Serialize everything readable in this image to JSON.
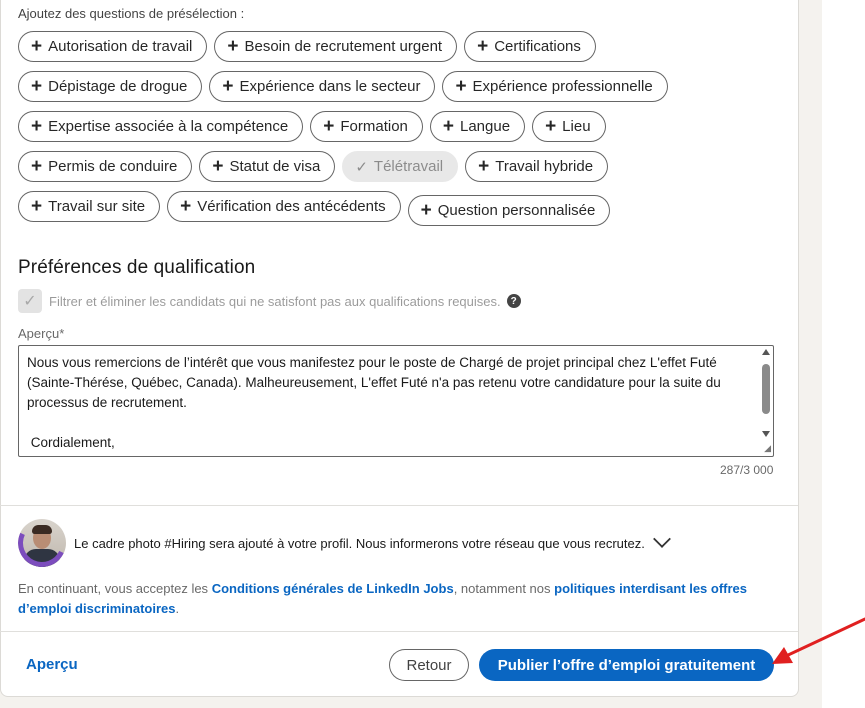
{
  "screening": {
    "hint": "Ajoutez des questions de présélection :",
    "rows": [
      [
        {
          "label": "Autorisation de travail"
        },
        {
          "label": "Besoin de recrutement urgent"
        },
        {
          "label": "Certifications"
        }
      ],
      [
        {
          "label": "Dépistage de drogue"
        },
        {
          "label": "Expérience dans le secteur"
        },
        {
          "label": "Expérience professionnelle"
        }
      ],
      [
        {
          "label": "Expertise associée à la compétence"
        },
        {
          "label": "Formation"
        },
        {
          "label": "Langue"
        },
        {
          "label": "Lieu"
        }
      ],
      [
        {
          "label": "Permis de conduire"
        },
        {
          "label": "Statut de visa"
        },
        {
          "label": "Télétravail",
          "selected": true
        },
        {
          "label": "Travail hybride"
        }
      ],
      [
        {
          "label": "Travail sur site"
        },
        {
          "label": "Vérification des antécédents"
        },
        {
          "label": "Question personnalisée"
        }
      ]
    ]
  },
  "qualification": {
    "title": "Préférences de qualification",
    "filter_label": "Filtrer et éliminer les candidats qui ne satisfont pas aux qualifications requises.",
    "preview_label": "Aperçu*",
    "preview_text": "Nous vous remercions de l’intérêt que vous manifestez pour le poste de Chargé de projet principal chez L'effet Futé (Sainte-Thérése, Québec, Canada). Malheureusement, L'effet Futé n'a pas retenu votre candidature pour la suite du processus de recrutement.\n\n Cordialement,\n L'effet Futé",
    "char_count": "287/3 000"
  },
  "hiring": {
    "text": "Le cadre photo #Hiring sera ajouté à votre profil. Nous informerons votre réseau que vous recrutez."
  },
  "legal": {
    "prefix": "En continuant, vous acceptez les ",
    "link1": "Conditions générales de LinkedIn Jobs",
    "middle": ", notamment nos ",
    "link2": "politiques interdisant les offres d’emploi discriminatoires",
    "suffix": "."
  },
  "footer": {
    "preview": "Aperçu",
    "back": "Retour",
    "publish": "Publier l’offre d’emploi gratuitement"
  },
  "colors": {
    "accent": "#0a66c2",
    "arrow": "#e02020"
  }
}
